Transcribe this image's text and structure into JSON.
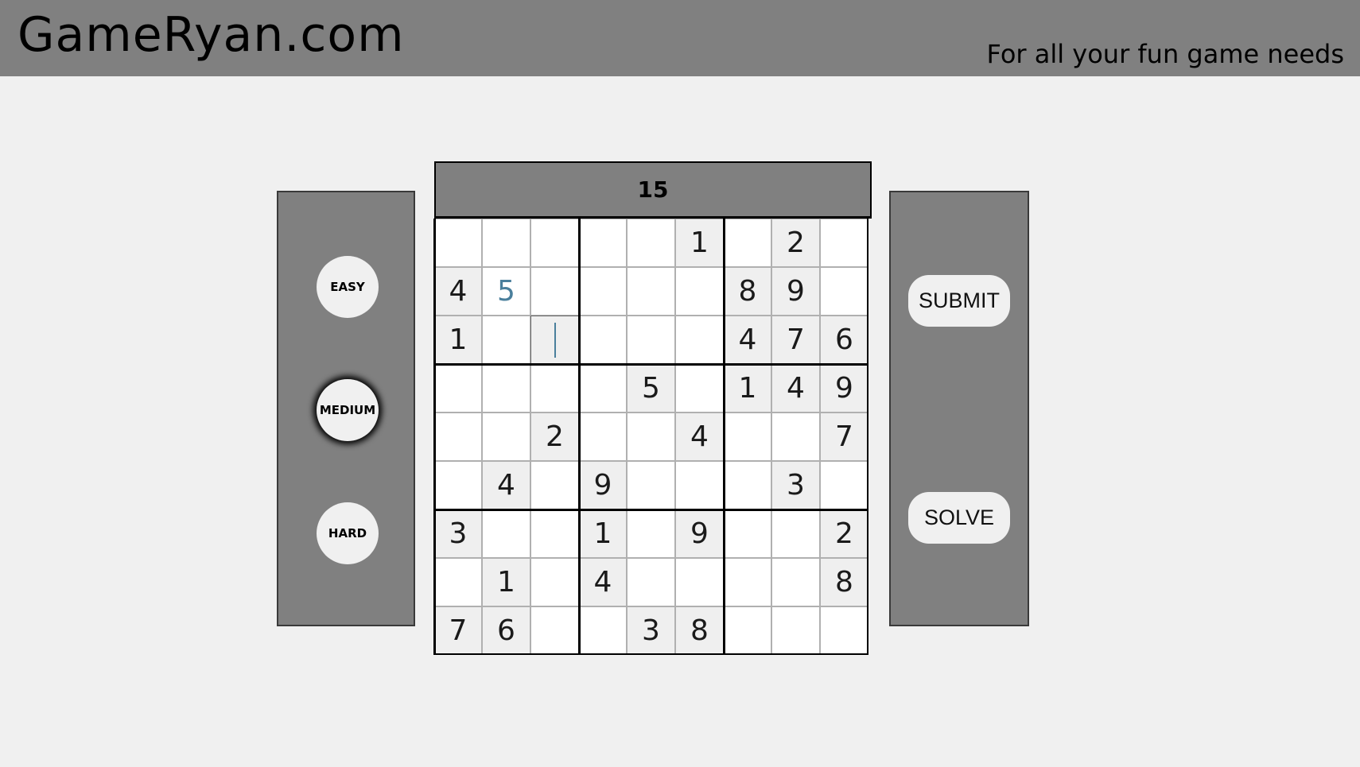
{
  "header": {
    "site_title": "GameRyan.com",
    "tagline": "For all your fun game needs"
  },
  "difficulty": {
    "easy_label": "EASY",
    "medium_label": "MEDIUM",
    "hard_label": "HARD",
    "selected": "MEDIUM"
  },
  "timer": "15",
  "actions": {
    "submit_label": "SUBMIT",
    "solve_label": "SOLVE"
  },
  "colors": {
    "header_bg": "#808080",
    "page_bg": "#f0f0f0",
    "entered_digit": "#4a7f9c"
  },
  "board": {
    "focused_cell": [
      2,
      2
    ],
    "rows": [
      [
        {
          "v": "",
          "t": "e"
        },
        {
          "v": "",
          "t": "e"
        },
        {
          "v": "",
          "t": "e"
        },
        {
          "v": "",
          "t": "e"
        },
        {
          "v": "",
          "t": "e"
        },
        {
          "v": "1",
          "t": "g"
        },
        {
          "v": "",
          "t": "e"
        },
        {
          "v": "2",
          "t": "g"
        },
        {
          "v": "",
          "t": "e"
        }
      ],
      [
        {
          "v": "4",
          "t": "g"
        },
        {
          "v": "5",
          "t": "u"
        },
        {
          "v": "",
          "t": "e"
        },
        {
          "v": "",
          "t": "e"
        },
        {
          "v": "",
          "t": "e"
        },
        {
          "v": "",
          "t": "e"
        },
        {
          "v": "8",
          "t": "g"
        },
        {
          "v": "9",
          "t": "g"
        },
        {
          "v": "",
          "t": "e"
        }
      ],
      [
        {
          "v": "1",
          "t": "g"
        },
        {
          "v": "",
          "t": "e"
        },
        {
          "v": "",
          "t": "f"
        },
        {
          "v": "",
          "t": "e"
        },
        {
          "v": "",
          "t": "e"
        },
        {
          "v": "",
          "t": "e"
        },
        {
          "v": "4",
          "t": "g"
        },
        {
          "v": "7",
          "t": "g"
        },
        {
          "v": "6",
          "t": "g"
        }
      ],
      [
        {
          "v": "",
          "t": "e"
        },
        {
          "v": "",
          "t": "e"
        },
        {
          "v": "",
          "t": "e"
        },
        {
          "v": "",
          "t": "e"
        },
        {
          "v": "5",
          "t": "g"
        },
        {
          "v": "",
          "t": "e"
        },
        {
          "v": "1",
          "t": "g"
        },
        {
          "v": "4",
          "t": "g"
        },
        {
          "v": "9",
          "t": "g"
        }
      ],
      [
        {
          "v": "",
          "t": "e"
        },
        {
          "v": "",
          "t": "e"
        },
        {
          "v": "2",
          "t": "g"
        },
        {
          "v": "",
          "t": "e"
        },
        {
          "v": "",
          "t": "e"
        },
        {
          "v": "4",
          "t": "g"
        },
        {
          "v": "",
          "t": "e"
        },
        {
          "v": "",
          "t": "e"
        },
        {
          "v": "7",
          "t": "g"
        }
      ],
      [
        {
          "v": "",
          "t": "e"
        },
        {
          "v": "4",
          "t": "g"
        },
        {
          "v": "",
          "t": "e"
        },
        {
          "v": "9",
          "t": "g"
        },
        {
          "v": "",
          "t": "e"
        },
        {
          "v": "",
          "t": "e"
        },
        {
          "v": "",
          "t": "e"
        },
        {
          "v": "3",
          "t": "g"
        },
        {
          "v": "",
          "t": "e"
        }
      ],
      [
        {
          "v": "3",
          "t": "g"
        },
        {
          "v": "",
          "t": "e"
        },
        {
          "v": "",
          "t": "e"
        },
        {
          "v": "1",
          "t": "g"
        },
        {
          "v": "",
          "t": "e"
        },
        {
          "v": "9",
          "t": "g"
        },
        {
          "v": "",
          "t": "e"
        },
        {
          "v": "",
          "t": "e"
        },
        {
          "v": "2",
          "t": "g"
        }
      ],
      [
        {
          "v": "",
          "t": "e"
        },
        {
          "v": "1",
          "t": "g"
        },
        {
          "v": "",
          "t": "e"
        },
        {
          "v": "4",
          "t": "g"
        },
        {
          "v": "",
          "t": "e"
        },
        {
          "v": "",
          "t": "e"
        },
        {
          "v": "",
          "t": "e"
        },
        {
          "v": "",
          "t": "e"
        },
        {
          "v": "8",
          "t": "g"
        }
      ],
      [
        {
          "v": "7",
          "t": "g"
        },
        {
          "v": "6",
          "t": "g"
        },
        {
          "v": "",
          "t": "e"
        },
        {
          "v": "",
          "t": "e"
        },
        {
          "v": "3",
          "t": "g"
        },
        {
          "v": "8",
          "t": "g"
        },
        {
          "v": "",
          "t": "e"
        },
        {
          "v": "",
          "t": "e"
        },
        {
          "v": "",
          "t": "e"
        }
      ]
    ]
  }
}
